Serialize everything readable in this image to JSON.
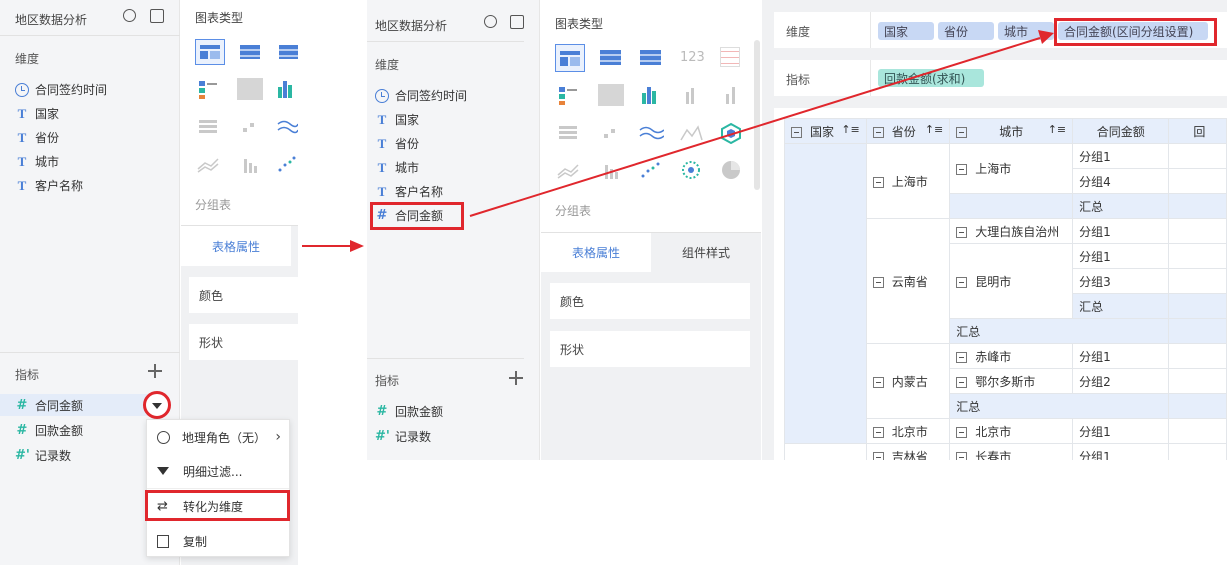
{
  "panelA": {
    "title": "地区数据分析",
    "dim_title": "维度",
    "dims": [
      "合同签约时间",
      "国家",
      "省份",
      "城市",
      "客户名称"
    ],
    "ind_title": "指标",
    "inds": [
      "合同金额",
      "回款金额",
      "记录数"
    ],
    "chart_type_title": "图表类型",
    "group_table": "分组表",
    "tab_table_props": "表格属性",
    "color": "颜色",
    "shape": "形状"
  },
  "menu": {
    "items": [
      "地理角色（无）",
      "明细过滤...",
      "转化为维度",
      "复制"
    ]
  },
  "panelB": {
    "title": "地区数据分析",
    "dim_title": "维度",
    "dims": [
      "合同签约时间",
      "国家",
      "省份",
      "城市",
      "客户名称",
      "合同金额"
    ],
    "ind_title": "指标",
    "inds": [
      "回款金额",
      "记录数"
    ],
    "chart_type_title": "图表类型",
    "group_table": "分组表",
    "tab_table_props": "表格属性",
    "tab_component_style": "组件样式",
    "color": "颜色",
    "shape": "形状"
  },
  "panelC": {
    "dim_label": "维度",
    "dim_tags": [
      "国家",
      "省份",
      "城市",
      "合同金额(区间分组设置)"
    ],
    "ind_label": "指标",
    "ind_tags": [
      "回款金额(求和)"
    ],
    "headers": [
      "国家",
      "省份",
      "城市",
      "合同金额",
      "回"
    ],
    "rows": {
      "shanghai": "上海市",
      "sh_city": "上海市",
      "g1": "分组1",
      "g4": "分组4",
      "sum": "汇总",
      "yunnan": "云南省",
      "dali": "大理白族自治州",
      "kunming": "昆明市",
      "g3": "分组3",
      "neimeng": "内蒙古",
      "chifeng": "赤峰市",
      "ordos": "鄂尔多斯市",
      "g2": "分组2",
      "beijing": "北京市",
      "bj_city": "北京市",
      "jilin": "吉林省",
      "changchun": "长春市"
    }
  },
  "icon_digits": "123",
  "colors": {
    "accent": "#4a7fd6",
    "red": "#e0272d",
    "teal": "#2bb7a3"
  }
}
